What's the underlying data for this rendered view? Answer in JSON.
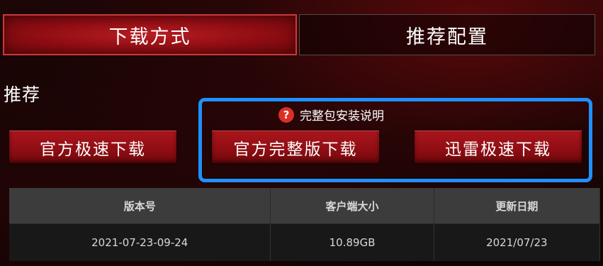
{
  "tabs": {
    "download": "下载方式",
    "config": "推荐配置"
  },
  "section": {
    "title": "推荐"
  },
  "note": {
    "icon": "question-icon",
    "text": "完整包安装说明"
  },
  "buttons": {
    "fast_official": "官方极速下载",
    "full_official": "官方完整版下载",
    "thunder": "迅雷极速下载"
  },
  "table": {
    "headers": [
      "版本号",
      "客户端大小",
      "更新日期"
    ],
    "row": [
      "2021-07-23-09-24",
      "10.89GB",
      "2021/07/23"
    ]
  },
  "colors": {
    "accent_red": "#a3121a",
    "highlight_blue": "#1e90ff",
    "help_icon_red": "#d92f27"
  }
}
